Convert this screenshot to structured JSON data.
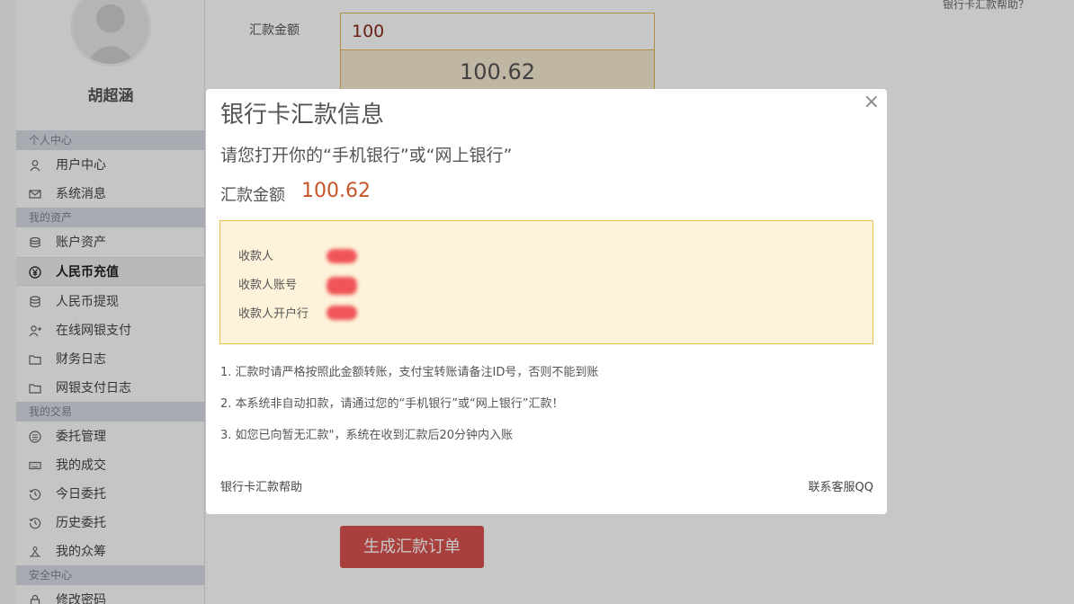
{
  "sidebar": {
    "username": "胡超涵",
    "sections": {
      "personal": "个人中心",
      "assets": "我的资产",
      "trade": "我的交易",
      "security": "安全中心"
    },
    "items": {
      "user_center": "用户中心",
      "messages": "系统消息",
      "account_assets": "账户资产",
      "rmb_recharge": "人民币充值",
      "rmb_withdraw": "人民币提现",
      "online_pay": "在线网银支付",
      "finance_log": "财务日志",
      "online_pay_log": "网银支付日志",
      "order_manage": "委托管理",
      "my_deals": "我的成交",
      "today_orders": "今日委托",
      "history_orders": "历史委托",
      "crowdfunding": "我的众筹",
      "change_password": "修改密码"
    }
  },
  "main": {
    "help_link": "银行卡汇款帮助？",
    "amount_label": "汇款金额",
    "amount_input": "100",
    "amount_total": "100.62",
    "generate_button": "生成汇款订单"
  },
  "modal": {
    "close": "×",
    "title": "银行卡汇款信息",
    "subtitle": "请您打开你的“手机银行”或“网上银行”",
    "amount_label": "汇款金额",
    "amount_value": "100.62",
    "payee_label": "收款人",
    "payee_account_label": "收款人账号",
    "payee_bank_label": "收款人开户行",
    "notes": [
      "1. 汇款时请严格按照此金额转账，支付宝转账请备注ID号，否则不能到账",
      "2. 本系统非自动扣款，请通过您的“手机银行”或“网上银行”汇款！",
      "3. 如您已向暂无汇款\"，系统在收到汇款后20分钟内入账"
    ],
    "help_link": "银行卡汇款帮助",
    "qq_link": "联系客服QQ"
  },
  "colors": {
    "accent_red": "#d9534f",
    "amount_orange": "#c8552a",
    "info_bg": "#fdf3da",
    "info_border": "#e9bd52"
  }
}
